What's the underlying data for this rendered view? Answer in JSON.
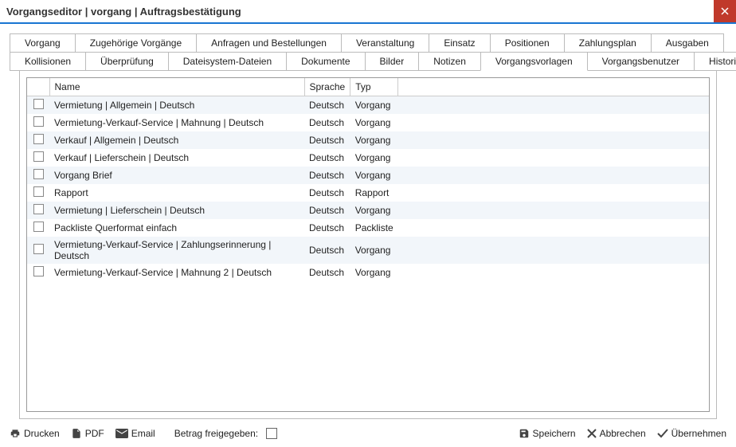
{
  "window": {
    "title": "Vorgangseditor |            vorgang | Auftragsbestätigung"
  },
  "tabs_row1": [
    {
      "label": "Vorgang"
    },
    {
      "label": "Zugehörige Vorgänge"
    },
    {
      "label": "Anfragen und Bestellungen"
    },
    {
      "label": "Veranstaltung"
    },
    {
      "label": "Einsatz"
    },
    {
      "label": "Positionen"
    },
    {
      "label": "Zahlungsplan"
    },
    {
      "label": "Ausgaben"
    }
  ],
  "tabs_row2": [
    {
      "label": "Kollisionen"
    },
    {
      "label": "Überprüfung"
    },
    {
      "label": "Dateisystem-Dateien"
    },
    {
      "label": "Dokumente"
    },
    {
      "label": "Bilder"
    },
    {
      "label": "Notizen"
    },
    {
      "label": "Vorgangsvorlagen",
      "active": true
    },
    {
      "label": "Vorgangsbenutzer"
    },
    {
      "label": "Historie"
    }
  ],
  "columns": {
    "name": "Name",
    "language": "Sprache",
    "type": "Typ"
  },
  "rows": [
    {
      "name": "Vermietung | Allgemein | Deutsch",
      "lang": "Deutsch",
      "typ": "Vorgang"
    },
    {
      "name": "Vermietung-Verkauf-Service | Mahnung | Deutsch",
      "lang": "Deutsch",
      "typ": "Vorgang"
    },
    {
      "name": "Verkauf | Allgemein | Deutsch",
      "lang": "Deutsch",
      "typ": "Vorgang"
    },
    {
      "name": "Verkauf | Lieferschein | Deutsch",
      "lang": "Deutsch",
      "typ": "Vorgang"
    },
    {
      "name": "Vorgang Brief",
      "lang": "Deutsch",
      "typ": "Vorgang"
    },
    {
      "name": "Rapport",
      "lang": "Deutsch",
      "typ": "Rapport"
    },
    {
      "name": "Vermietung | Lieferschein | Deutsch",
      "lang": "Deutsch",
      "typ": "Vorgang"
    },
    {
      "name": "Packliste Querformat einfach",
      "lang": "Deutsch",
      "typ": "Packliste"
    },
    {
      "name": "Vermietung-Verkauf-Service | Zahlungserinnerung | Deutsch",
      "lang": "Deutsch",
      "typ": "Vorgang"
    },
    {
      "name": "Vermietung-Verkauf-Service | Mahnung 2 | Deutsch",
      "lang": "Deutsch",
      "typ": "Vorgang"
    }
  ],
  "footer": {
    "print": "Drucken",
    "pdf": "PDF",
    "email": "Email",
    "released": "Betrag freigegeben:",
    "save": "Speichern",
    "cancel": "Abbrechen",
    "apply": "Übernehmen"
  }
}
